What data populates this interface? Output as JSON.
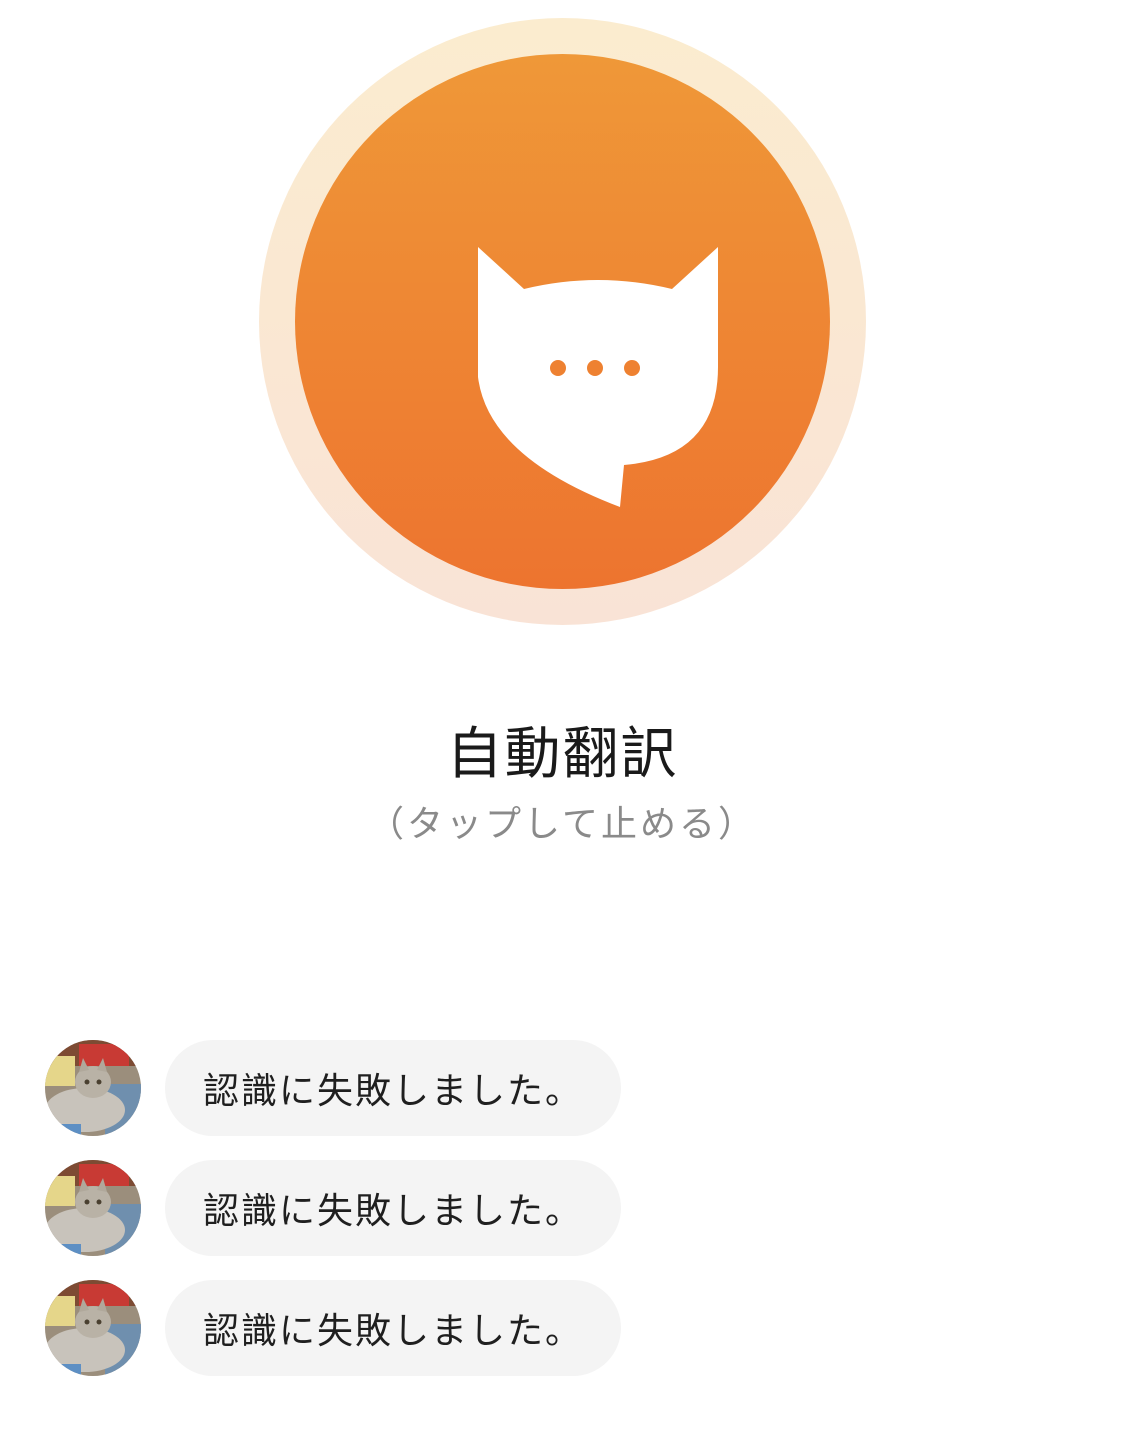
{
  "record": {
    "icon": "cat-speech-bubble-icon",
    "halo_color": "#fbeccf",
    "core_gradient": [
      "#ef9838",
      "#ed742f"
    ]
  },
  "mode": {
    "title": "自動翻訳",
    "hint": "（タップして止める）"
  },
  "history": {
    "items": [
      {
        "avatar": "cat-photo-avatar",
        "text": "認識に失敗しました。"
      },
      {
        "avatar": "cat-photo-avatar",
        "text": "認識に失敗しました。"
      },
      {
        "avatar": "cat-photo-avatar",
        "text": "認識に失敗しました。"
      }
    ]
  }
}
